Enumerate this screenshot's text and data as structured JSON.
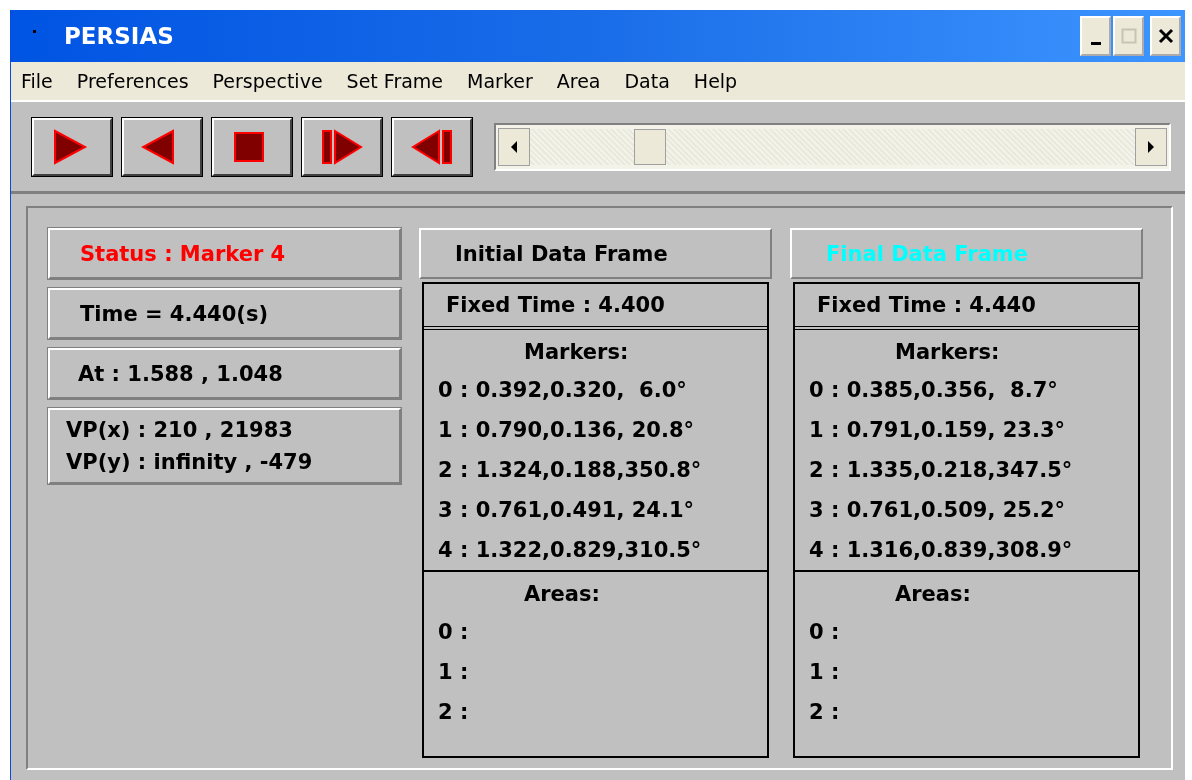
{
  "window": {
    "title": "PERSIAS"
  },
  "menu": [
    "File",
    "Preferences",
    "Perspective",
    "Set Frame",
    "Marker",
    "Area",
    "Data",
    "Help"
  ],
  "transport": [
    {
      "kind": "play"
    },
    {
      "kind": "reverse"
    },
    {
      "kind": "stop"
    },
    {
      "kind": "step-forward"
    },
    {
      "kind": "step-back"
    }
  ],
  "info": [
    {
      "lines": [
        "Status : Marker 4"
      ],
      "color": "#ff0000"
    },
    {
      "lines": [
        "Time = 4.440(s)"
      ],
      "color": "#000000"
    },
    {
      "lines": [
        "At : 1.588 , 1.048"
      ],
      "color": "#000000"
    },
    {
      "lines": [
        "VP(x) : 210 , 21983",
        "VP(y) : infinity , -479"
      ],
      "color": "#000000"
    }
  ],
  "frames": [
    {
      "title": "Initial Data Frame",
      "color": "#000000",
      "fixed_time": "Fixed Time : 4.400",
      "markers_label": "Markers:",
      "markers": [
        "0 : 0.392,0.320,  6.0°",
        "1 : 0.790,0.136, 20.8°",
        "2 : 1.324,0.188,350.8°",
        "3 : 0.761,0.491, 24.1°",
        "4 : 1.322,0.829,310.5°"
      ],
      "areas_label": "Areas:",
      "areas": [
        "0 :",
        "1 :",
        "2 :"
      ]
    },
    {
      "title": "Final Data Frame",
      "color": "#00ffff",
      "fixed_time": "Fixed Time : 4.440",
      "markers_label": "Markers:",
      "markers": [
        "0 : 0.385,0.356,  8.7°",
        "1 : 0.791,0.159, 23.3°",
        "2 : 1.335,0.218,347.5°",
        "3 : 0.761,0.509, 25.2°",
        "4 : 1.316,0.839,308.9°"
      ],
      "areas_label": "Areas:",
      "areas": [
        "0 :",
        "1 :",
        "2 :"
      ]
    }
  ]
}
